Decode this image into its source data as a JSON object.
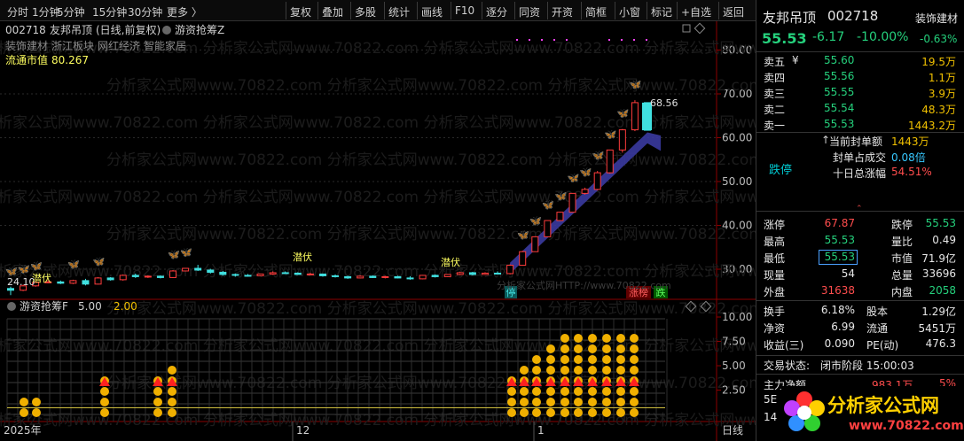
{
  "toolbar": {
    "periods": [
      "分时",
      "1分钟",
      "5分钟",
      "15分钟",
      "30分钟",
      "更多 〉"
    ],
    "tools": [
      "复权",
      "叠加",
      "多股",
      "统计",
      "画线",
      "F10",
      "逐分",
      "同资",
      "开资",
      "简框",
      "小窗",
      "标记",
      "+自选",
      "返回"
    ]
  },
  "stock": {
    "code": "002718",
    "name": "友邦吊顶",
    "mode": "(日线,前复权)",
    "indicator": "游资抢筹Z",
    "industry": "装饰建材",
    "concepts": [
      "装饰建材",
      "浙江板块",
      "网红经济",
      "智能家居"
    ],
    "float_cap_label": "流通市值",
    "float_cap": "80.267"
  },
  "price_axis": {
    "ticks": [
      "80.00",
      "70.00",
      "60.00",
      "50.00",
      "40.00",
      "30.00"
    ]
  },
  "annotations": {
    "max_price": "68.56",
    "min_price": "24.10",
    "lurk1": "潜伏",
    "lurk2": "潜伏",
    "lurk3": "潜伏",
    "ting": "停",
    "zhangbang": "涨榜",
    "die": "跌"
  },
  "indicator": {
    "title": "游资抢筹F",
    "param1": "5.00",
    "param2": "2.00",
    "ticks": [
      "10.00",
      "7.50",
      "5.00",
      "2.50"
    ]
  },
  "xaxis": {
    "labels": [
      "2025年",
      "12",
      "1"
    ],
    "mode": "日线"
  },
  "watermark": "分析家公式网www.70822.com",
  "watermark2": "分析家公式网HTTP://www.70822.com",
  "candles": [
    [
      25.6,
      26.0,
      24.1,
      25.2
    ],
    [
      25.2,
      26.5,
      25.0,
      26.2
    ],
    [
      26.2,
      27.2,
      26.0,
      27.0
    ],
    [
      27.0,
      27.5,
      26.8,
      27.1
    ],
    [
      27.1,
      27.4,
      26.6,
      26.8
    ],
    [
      26.8,
      27.6,
      26.6,
      27.4
    ],
    [
      27.4,
      27.8,
      26.3,
      26.6
    ],
    [
      26.6,
      28.2,
      26.5,
      28.0
    ],
    [
      28.0,
      28.2,
      27.4,
      27.6
    ],
    [
      27.6,
      28.8,
      27.4,
      28.6
    ],
    [
      28.6,
      29.0,
      28.0,
      28.3
    ],
    [
      28.3,
      28.6,
      28.0,
      28.4
    ],
    [
      28.4,
      28.6,
      27.9,
      28.1
    ],
    [
      28.1,
      29.8,
      28.0,
      29.6
    ],
    [
      29.6,
      30.3,
      29.5,
      30.2
    ],
    [
      30.2,
      31.0,
      29.6,
      29.8
    ],
    [
      29.8,
      30.1,
      29.0,
      29.3
    ],
    [
      29.3,
      29.6,
      28.5,
      28.8
    ],
    [
      28.8,
      29.0,
      28.3,
      28.6
    ],
    [
      28.6,
      28.9,
      28.3,
      28.5
    ],
    [
      28.5,
      29.0,
      28.4,
      28.9
    ],
    [
      28.9,
      29.5,
      28.7,
      29.2
    ],
    [
      29.2,
      29.5,
      28.9,
      29.1
    ],
    [
      29.1,
      29.3,
      28.7,
      28.8
    ],
    [
      28.8,
      29.2,
      28.7,
      28.9
    ],
    [
      28.9,
      29.0,
      28.3,
      28.5
    ],
    [
      28.5,
      28.8,
      28.1,
      28.3
    ],
    [
      28.3,
      28.5,
      27.8,
      28.0
    ],
    [
      28.0,
      28.6,
      27.9,
      28.4
    ],
    [
      28.4,
      28.6,
      28.0,
      28.1
    ],
    [
      28.1,
      28.5,
      27.9,
      28.3
    ],
    [
      28.3,
      28.5,
      27.9,
      28.0
    ],
    [
      28.0,
      28.4,
      27.6,
      27.8
    ],
    [
      27.8,
      28.7,
      27.7,
      28.6
    ],
    [
      28.6,
      28.8,
      28.1,
      28.3
    ],
    [
      28.3,
      28.9,
      28.2,
      28.8
    ],
    [
      28.8,
      29.4,
      28.6,
      29.2
    ],
    [
      29.2,
      29.4,
      28.6,
      28.8
    ],
    [
      28.8,
      29.3,
      28.7,
      29.1
    ],
    [
      29.1,
      29.5,
      28.9,
      29.0
    ],
    [
      29.0,
      31.1,
      28.8,
      30.9
    ],
    [
      30.9,
      34.2,
      30.8,
      34.0
    ],
    [
      34.0,
      37.5,
      34.0,
      37.4
    ],
    [
      37.4,
      41.1,
      37.4,
      41.1
    ],
    [
      41.1,
      43.1,
      41.0,
      43.0
    ],
    [
      43.0,
      47.3,
      43.0,
      47.3
    ],
    [
      47.3,
      48.6,
      47.0,
      48.2
    ],
    [
      48.2,
      52.4,
      48.0,
      52.0
    ],
    [
      52.0,
      57.2,
      51.8,
      57.2
    ],
    [
      57.2,
      62.0,
      56.6,
      61.8
    ],
    [
      61.8,
      68.56,
      61.5,
      68.0
    ],
    [
      68.0,
      68.0,
      61.7,
      61.7
    ]
  ],
  "dot_stacks": [
    2,
    2,
    0,
    0,
    0,
    0,
    0,
    0,
    4,
    0,
    0,
    0,
    0,
    0,
    0,
    0,
    4,
    4,
    5,
    0,
    0,
    0,
    0,
    0,
    0,
    0,
    0,
    0,
    0,
    0,
    0,
    0,
    0,
    0,
    0,
    0,
    0,
    0,
    0,
    0,
    0,
    0,
    0,
    0,
    0,
    0,
    0,
    0,
    0,
    0,
    0,
    0,
    0,
    0,
    0,
    0,
    0,
    0,
    0,
    0,
    0,
    0,
    0,
    0,
    0,
    0,
    0,
    0,
    0,
    0,
    0,
    0,
    0,
    0,
    0,
    0,
    0,
    0,
    0,
    0,
    0,
    0
  ],
  "quote": {
    "price": "55.53",
    "change": "-6.17",
    "pct": "-10.00%",
    "industry_pct": "-0.63%",
    "sells": [
      {
        "l": "卖五",
        "y": "¥",
        "p": "55.60",
        "v": "19.5万"
      },
      {
        "l": "卖四",
        "y": "",
        "p": "55.56",
        "v": "1.1万"
      },
      {
        "l": "卖三",
        "y": "",
        "p": "55.55",
        "v": "3.9万"
      },
      {
        "l": "卖二",
        "y": "",
        "p": "55.54",
        "v": "48.3万"
      },
      {
        "l": "卖一",
        "y": "",
        "p": "55.53",
        "v": "1443.2万"
      }
    ],
    "seal_label": "当前封单额",
    "seal": "1443万",
    "seal_ratio_label": "封单占成交",
    "seal_ratio": "0.08倍",
    "ten_label": "十日总涨幅",
    "ten": "54.51%",
    "limit_state": "跌停",
    "stats": [
      [
        {
          "l": "涨停",
          "v": "67.87",
          "c": "#ff4d4d"
        },
        {
          "l": "跌停",
          "v": "55.53",
          "c": "#25d07c"
        }
      ],
      [
        {
          "l": "最高",
          "v": "55.53",
          "c": "#25d07c"
        },
        {
          "l": "量比",
          "v": "0.49",
          "c": "#e6e6e6"
        }
      ],
      [
        {
          "l": "最低",
          "v": "55.53",
          "c": "#25d07c"
        },
        {
          "l": "市值",
          "v": "71.9亿",
          "c": "#e6e6e6"
        }
      ],
      [
        {
          "l": "现量",
          "v": "54",
          "c": "#e6e6e6"
        },
        {
          "l": "总量",
          "v": "33696",
          "c": "#e6e6e6"
        }
      ],
      [
        {
          "l": "外盘",
          "v": "31638",
          "c": "#ff4d4d"
        },
        {
          "l": "内盘",
          "v": "2058",
          "c": "#25d07c"
        }
      ]
    ],
    "stats2": [
      [
        {
          "l": "换手",
          "v": "6.18%"
        },
        {
          "l": "股本",
          "v": "1.29亿"
        }
      ],
      [
        {
          "l": "净资",
          "v": "6.99"
        },
        {
          "l": "流通",
          "v": "5451万"
        }
      ],
      [
        {
          "l": "收益(三)",
          "v": "0.090"
        },
        {
          "l": "PE(动)",
          "v": "476.3"
        }
      ]
    ],
    "trade_state_label": "交易状态:",
    "trade_state": "闭市阶段 15:00:03",
    "main_net_label": "主力净额",
    "main_net": "983.1万",
    "main_net_pct": "5%",
    "row_5e": "5E",
    "row_14": "14"
  },
  "logo": {
    "name": "分析家公式网",
    "url": "www.70822.com"
  }
}
